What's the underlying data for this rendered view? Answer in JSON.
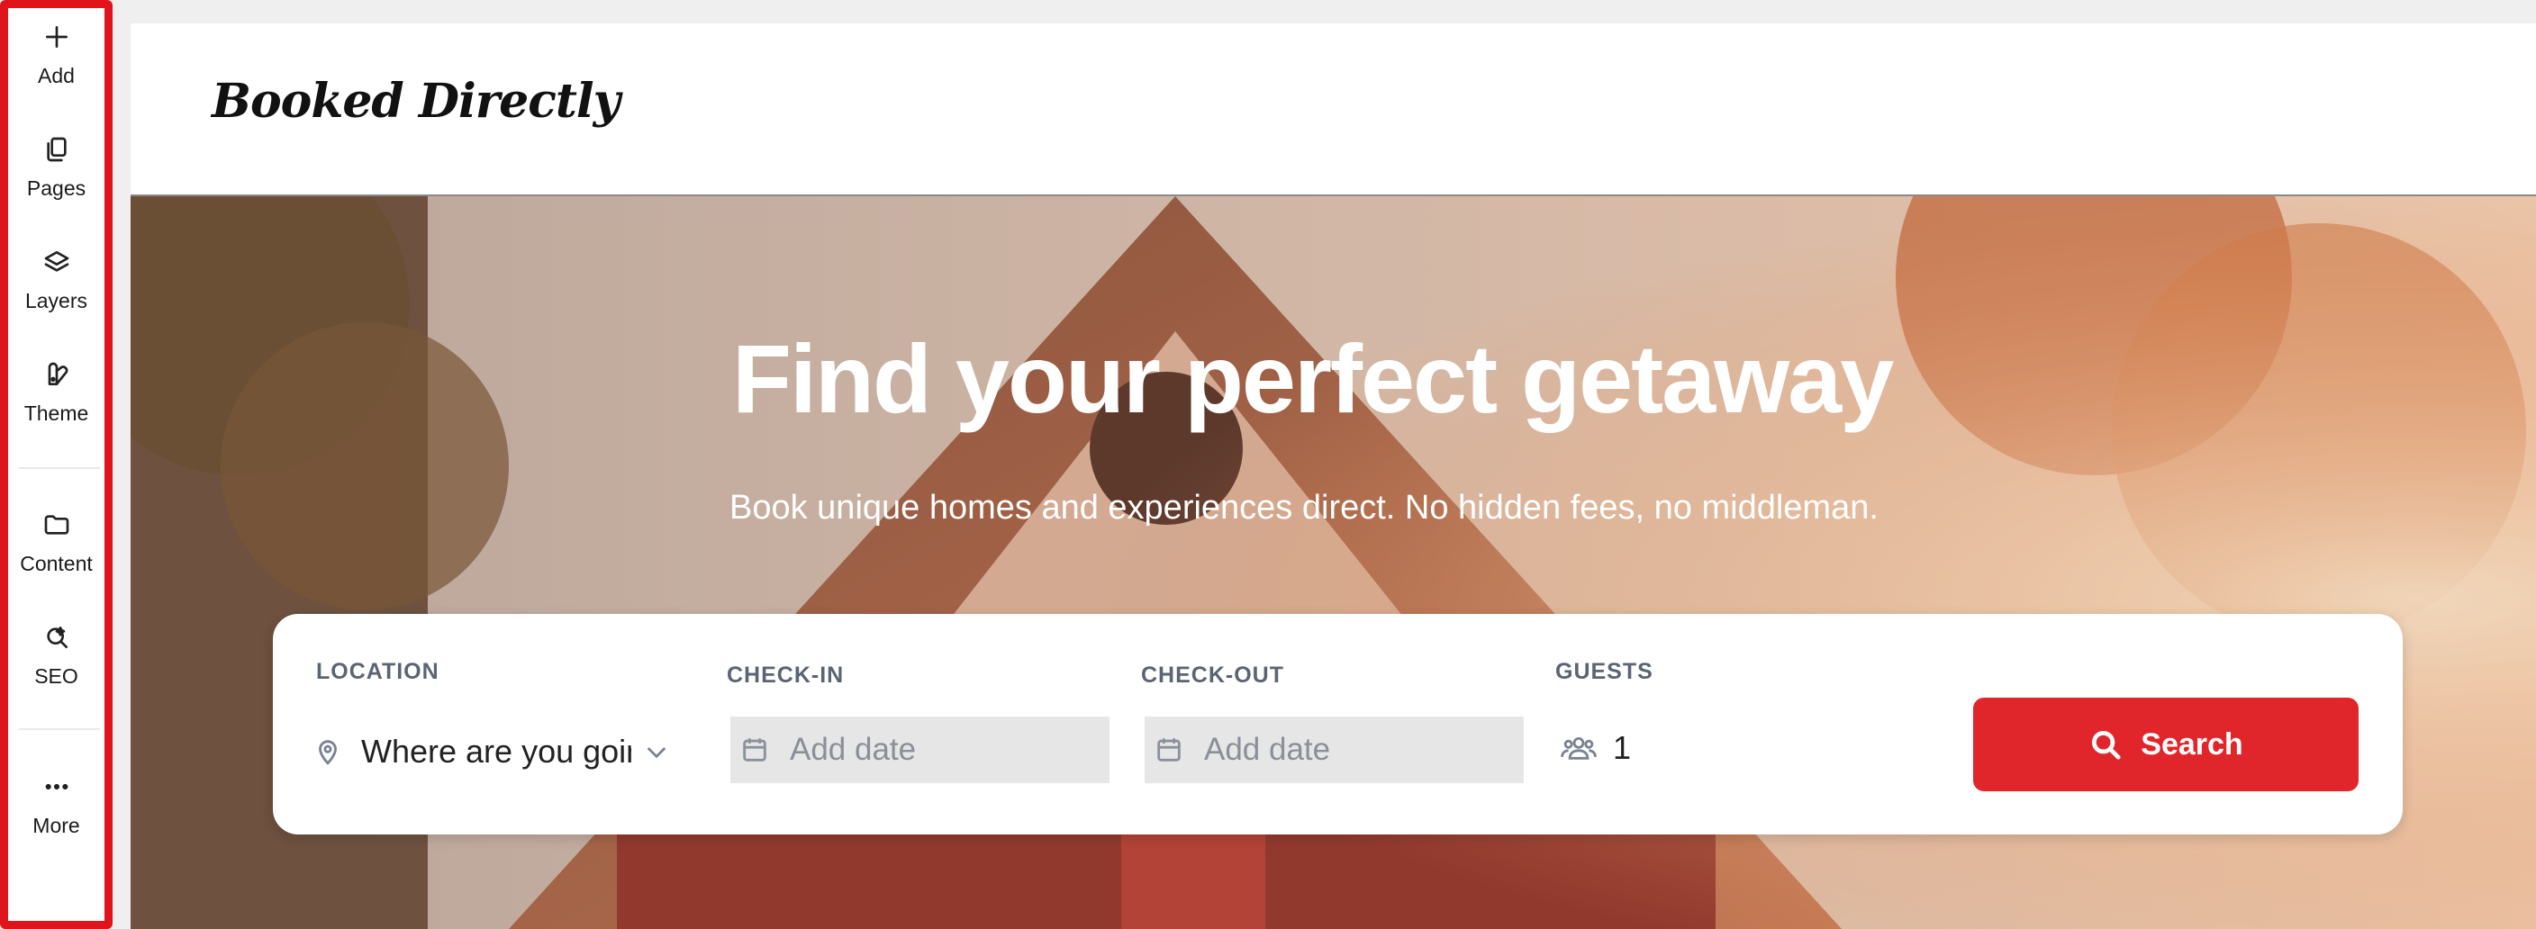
{
  "toolbar": {
    "items": [
      {
        "label": "Add",
        "icon": "plus-icon"
      },
      {
        "label": "Pages",
        "icon": "pages-icon"
      },
      {
        "label": "Layers",
        "icon": "layers-icon"
      },
      {
        "label": "Theme",
        "icon": "theme-icon"
      },
      {
        "label": "Content",
        "icon": "folder-icon"
      },
      {
        "label": "SEO",
        "icon": "seo-icon"
      },
      {
        "label": "More",
        "icon": "more-icon"
      }
    ]
  },
  "site": {
    "logo": "Booked Directly"
  },
  "hero": {
    "title": "Find your perfect getaway",
    "subtitle": "Book unique homes and experiences direct. No hidden fees, no middleman."
  },
  "booking": {
    "location_label": "LOCATION",
    "location_value": "Where are you going?",
    "checkin_label": "CHECK-IN",
    "checkin_placeholder": "Add date",
    "checkout_label": "CHECK-OUT",
    "checkout_placeholder": "Add date",
    "guests_label": "GUESTS",
    "guests_value": "1",
    "search_label": "Search"
  },
  "colors": {
    "accent": "#e0262a",
    "toolbar_outline": "#e0141b"
  }
}
